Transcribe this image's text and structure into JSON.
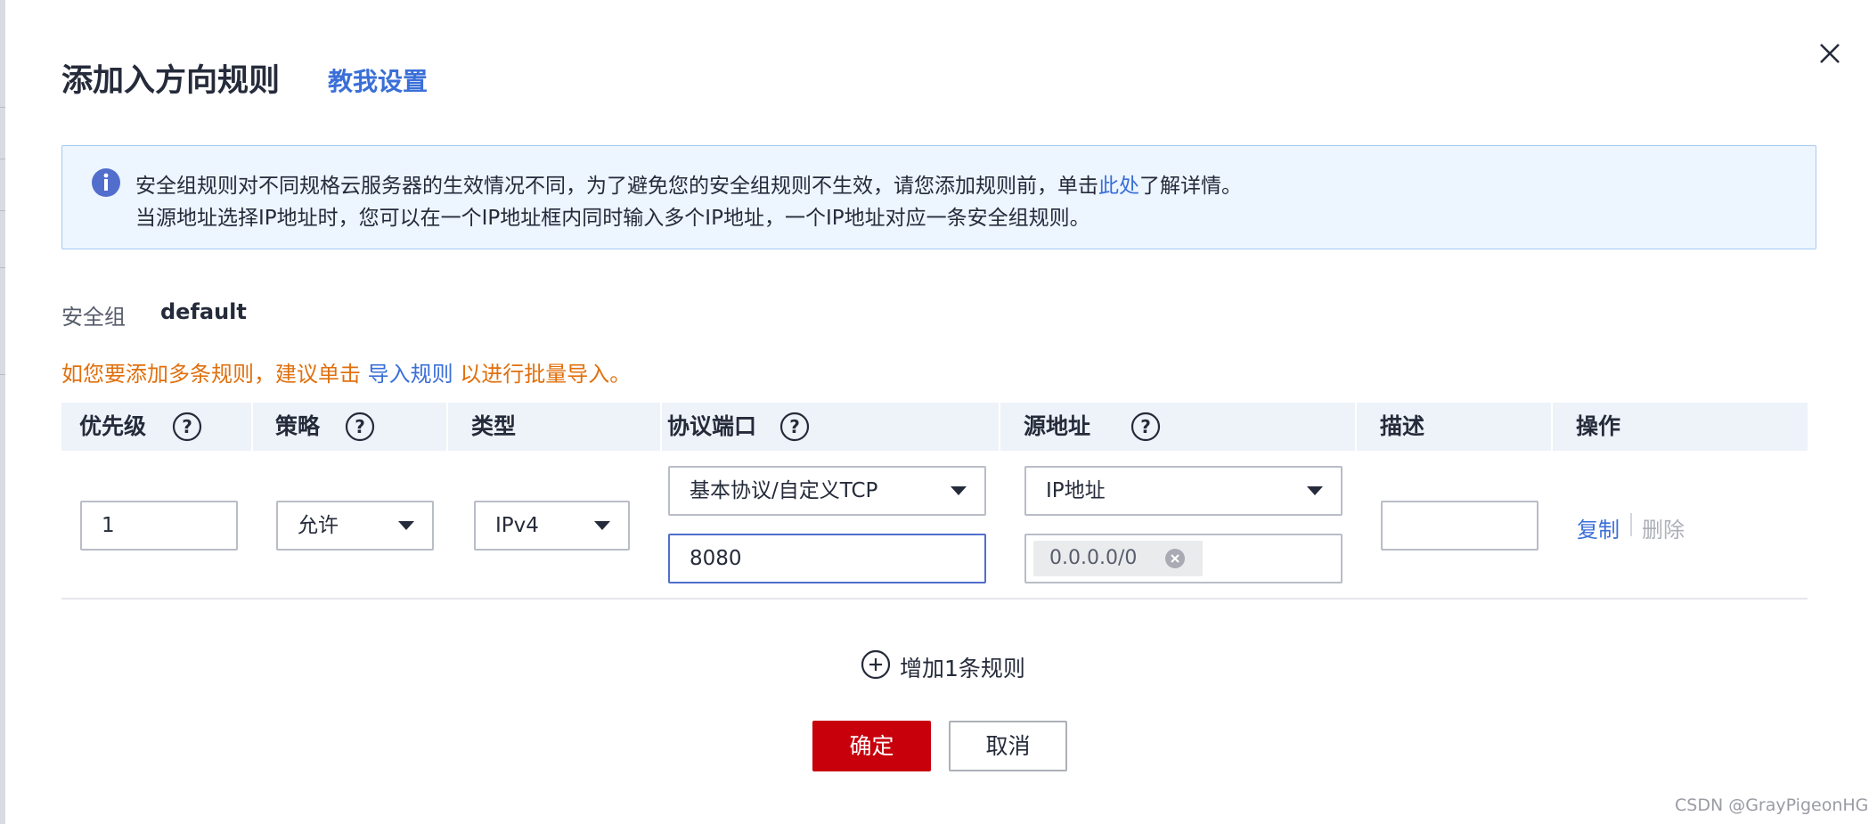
{
  "dialog": {
    "title": "添加入方向规则",
    "help_link": "教我设置",
    "close_icon": "close-icon"
  },
  "notice": {
    "line1_prefix": "安全组规则对不同规格云服务器的生效情况不同，为了避免您的安全组规则不生效，请您添加规则前，单击",
    "line1_link": "此处",
    "line1_suffix": "了解详情。",
    "line2": "当源地址选择IP地址时，您可以在一个IP地址框内同时输入多个IP地址，一个IP地址对应一条安全组规则。"
  },
  "security_group": {
    "label": "安全组",
    "value": "default"
  },
  "hint": {
    "prefix": "如您要添加多条规则，建议单击 ",
    "link": "导入规则",
    "suffix": " 以进行批量导入。"
  },
  "table": {
    "headers": {
      "priority": "优先级",
      "strategy": "策略",
      "type": "类型",
      "protocol_port": "协议端口",
      "source": "源地址",
      "description": "描述",
      "actions": "操作"
    },
    "row": {
      "priority": "1",
      "strategy": "允许",
      "type": "IPv4",
      "protocol": "基本协议/自定义TCP",
      "port": "8080",
      "source_type": "IP地址",
      "source_ip": "0.0.0.0/0",
      "description": "",
      "copy": "复制",
      "delete": "删除"
    }
  },
  "add_rule": "增加1条规则",
  "buttons": {
    "confirm": "确定",
    "cancel": "取消"
  },
  "watermark": "CSDN @GrayPigeonHGH",
  "colors": {
    "primary": "#c7000b",
    "link": "#3a6fd8",
    "hint": "#e0700e",
    "notice_bg": "#edf5ff"
  }
}
